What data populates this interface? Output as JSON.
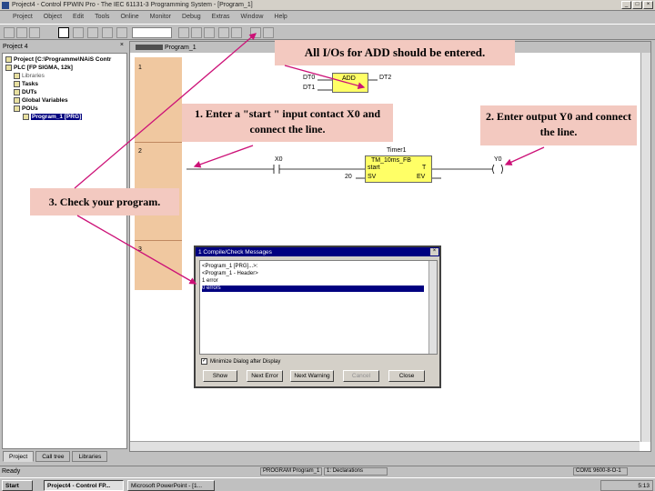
{
  "window": {
    "title": "Project4 - Control FPWIN Pro - The IEC 61131-3 Programming System - [Program_1]",
    "minimize": "_",
    "maximize": "□",
    "close": "×"
  },
  "menu": [
    "Project",
    "Object",
    "Edit",
    "Tools",
    "Online",
    "Monitor",
    "Debug",
    "Extras",
    "Window",
    "Help"
  ],
  "project_pane": {
    "title": "Project 4",
    "close": "×",
    "tree": [
      {
        "label": "Project [C:\\Programme\\NAiS Contr",
        "style": "bold"
      },
      {
        "label": "PLC [FP SIGMA, 12k]",
        "style": "bold"
      },
      {
        "label": "Libraries",
        "style": "normal"
      },
      {
        "label": "Tasks",
        "style": "bold"
      },
      {
        "label": "DUTs",
        "style": "bold"
      },
      {
        "label": "Global Variables",
        "style": "bold"
      },
      {
        "label": "POUs",
        "style": "bold"
      },
      {
        "label": "Program_1 [PRG]",
        "style": "selected"
      }
    ],
    "tabs": [
      "Project",
      "Call tree",
      "Libraries"
    ]
  },
  "editor": {
    "tab": "Program_1",
    "networks": [
      "1",
      "2",
      "3"
    ],
    "add_block": {
      "name": "ADD",
      "in1": "DT0",
      "in2": "DT1",
      "out": "DT2"
    },
    "contact": "X0",
    "timer": {
      "instance": "Timer1",
      "type": "TM_10ms_FB",
      "in_start": "start",
      "in_sv": "SV",
      "out_t": "T",
      "out_ev": "EV",
      "sv_value": "20"
    },
    "coil": "Y0"
  },
  "dialog": {
    "title": "1 Compile/Check Messages",
    "close": "×",
    "lines": [
      {
        "text": "<Program_1 [PRG]...>:",
        "highlight": false
      },
      {
        "text": "<Program_1 - Header>",
        "highlight": false
      },
      {
        "text": "1 error",
        "highlight": false
      },
      {
        "text": "0 errors",
        "highlight": true
      }
    ],
    "checkbox_label": "Minimize Dialog after Display",
    "checkbox_checked": "✓",
    "buttons": [
      {
        "label": "Show",
        "disabled": false
      },
      {
        "label": "Next Error",
        "disabled": false
      },
      {
        "label": "Next Warning",
        "disabled": false
      },
      {
        "label": "Cancel",
        "disabled": true
      },
      {
        "label": "Close",
        "disabled": false
      }
    ]
  },
  "statusbar": {
    "left": "Ready",
    "program": "PROGRAM Program_1",
    "declarations": "1: Declarations",
    "com": "COM1 9600-8-O-1"
  },
  "taskbar": {
    "start": "Start",
    "tasks": [
      "Project4 - Control FP...",
      "Microsoft PowerPoint - [1..."
    ],
    "clock": "5:13"
  },
  "callouts": {
    "top": "All I/Os for ADD should be entered.",
    "step1": "1. Enter a \"start \" input contact X0 and connect the line.",
    "step2": "2. Enter output Y0 and connect the line.",
    "step3": "3. Check your program."
  },
  "colors": {
    "callout_bg": "#f3c9c0",
    "arrow": "#cc1177",
    "function_block": "#ffff66",
    "network_margin": "#f0c8a0",
    "selection": "#000080"
  }
}
